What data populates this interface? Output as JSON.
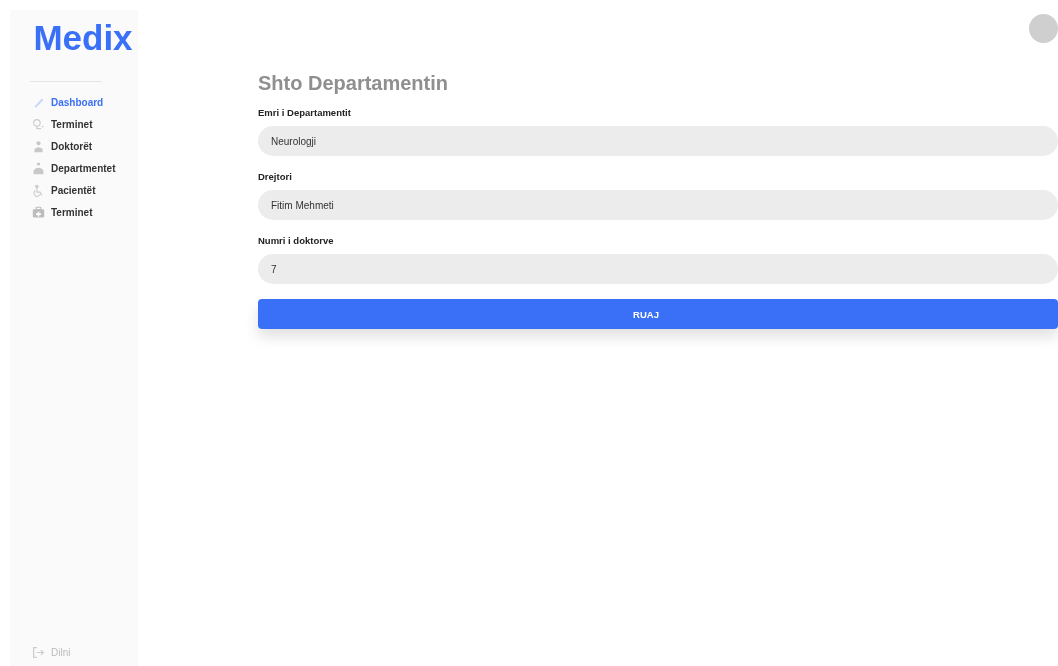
{
  "logo": "Medix",
  "nav": [
    {
      "label": "Dashboard",
      "selected": true
    },
    {
      "label": "Terminet",
      "selected": false
    },
    {
      "label": "Doktorët",
      "selected": false
    },
    {
      "label": "Departmentet",
      "selected": false
    },
    {
      "label": "Pacientët",
      "selected": false
    },
    {
      "label": "Terminet",
      "selected": false
    }
  ],
  "logout": "Dilni",
  "form": {
    "title": "Shto Departamentin",
    "fields": [
      {
        "label": "Emri i Departamentit",
        "value": "Neurologji"
      },
      {
        "label": "Drejtori",
        "value": "Fitim Mehmeti"
      },
      {
        "label": "Numri i doktorve",
        "value": "7"
      }
    ],
    "submit": "RUAJ"
  }
}
